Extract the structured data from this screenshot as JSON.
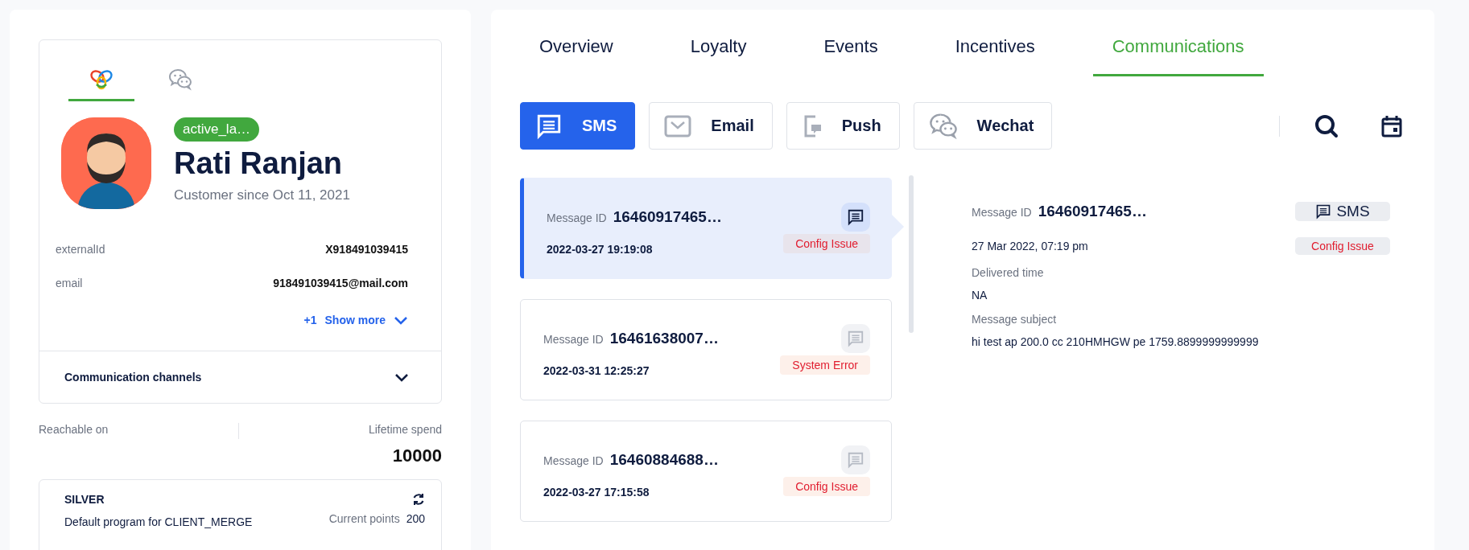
{
  "profile": {
    "icon_tabs": [
      {
        "kind": "brand",
        "selected": true
      },
      {
        "kind": "wechat",
        "selected": false
      }
    ],
    "tag": "active_la…",
    "name": "Rati Ranjan",
    "since": "Customer since Oct 11, 2021",
    "fields": [
      {
        "label": "externalId",
        "value": "X918491039415"
      },
      {
        "label": "email",
        "value": "918491039415@mail.com"
      }
    ],
    "more_count": "+1",
    "show_more": "Show more",
    "channels_title": "Communication channels",
    "channels_expanded": false
  },
  "stats": {
    "reachable_label": "Reachable on",
    "spend_label": "Lifetime spend",
    "spend_value": "10000"
  },
  "program": {
    "tier": "SILVER",
    "name": "Default program for CLIENT_MERGE",
    "points_label": "Current points",
    "points": "200"
  },
  "tabs": [
    {
      "label": "Overview",
      "selected": false
    },
    {
      "label": "Loyalty",
      "selected": false
    },
    {
      "label": "Events",
      "selected": false
    },
    {
      "label": "Incentives",
      "selected": false
    },
    {
      "label": "Communications",
      "selected": true
    }
  ],
  "channels": [
    {
      "kind": "sms",
      "label": "SMS",
      "selected": true
    },
    {
      "kind": "email",
      "label": "Email",
      "selected": false
    },
    {
      "kind": "push",
      "label": "Push",
      "selected": false
    },
    {
      "kind": "wechat",
      "label": "Wechat",
      "selected": false
    }
  ],
  "messages": [
    {
      "id_label": "Message ID",
      "id": "16460917465…",
      "time": "2022-03-27 19:19:08",
      "status": "Config Issue",
      "selected": true
    },
    {
      "id_label": "Message ID",
      "id": "16461638007…",
      "time": "2022-03-31 12:25:27",
      "status": "System Error",
      "selected": false
    },
    {
      "id_label": "Message ID",
      "id": "16460884688…",
      "time": "2022-03-27 17:15:58",
      "status": "Config Issue",
      "selected": false
    }
  ],
  "detail": {
    "id_label": "Message ID",
    "id": "16460917465…",
    "channel": "SMS",
    "date": "27 Mar 2022, 07:19 pm",
    "status": "Config Issue",
    "fields": [
      {
        "label": "Delivered time",
        "value": "NA"
      },
      {
        "label": "Message subject",
        "value": "hi test ap 200.0 cc 210HMHGW pe 1759.8899999999999"
      }
    ]
  }
}
